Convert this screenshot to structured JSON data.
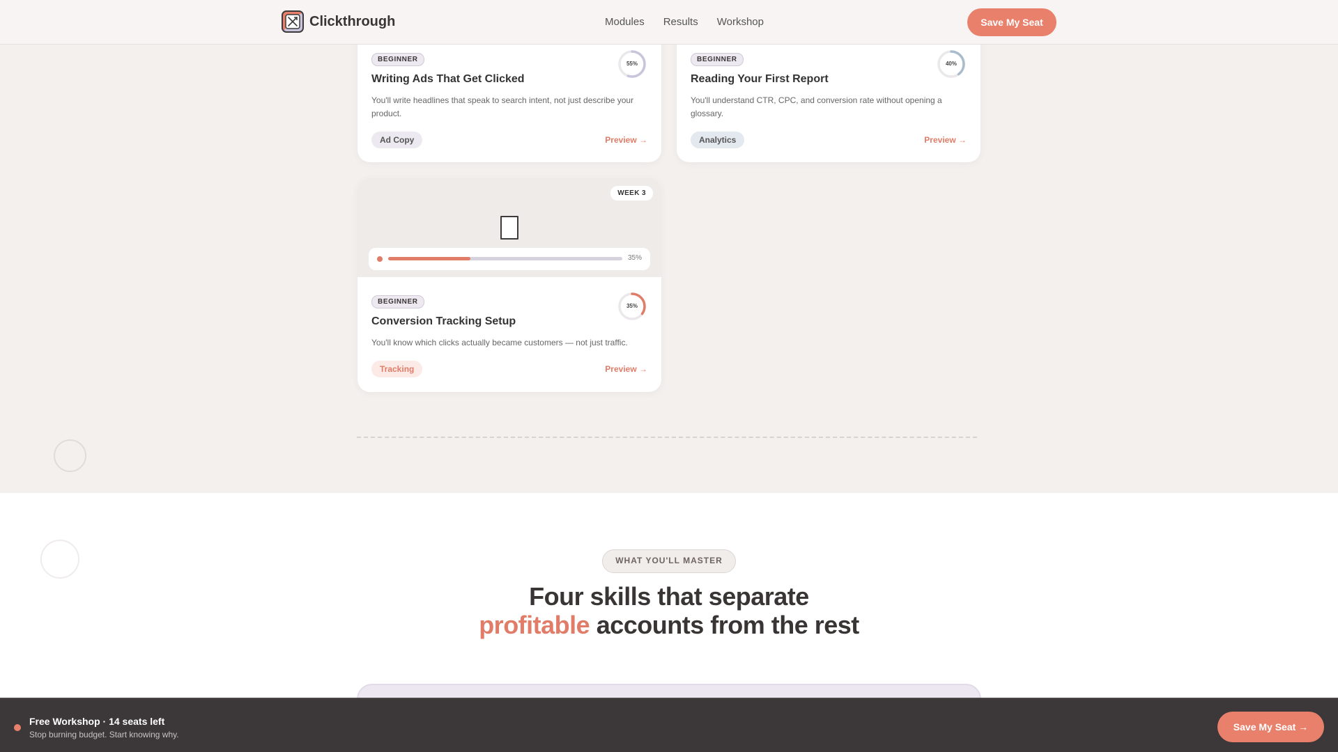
{
  "header": {
    "brand": "Clickthrough",
    "nav": [
      "Modules",
      "Results",
      "Workshop"
    ],
    "cta": "Save My Seat"
  },
  "cards": [
    {
      "level": "BEGINNER",
      "title": "Writing Ads That Get Clicked",
      "desc": "You'll write headlines that speak to search intent, not just describe your product.",
      "progress_pct": 55,
      "progress_label": "55%",
      "ring_color": "#c9c5dc",
      "tag": "Ad Copy",
      "tag_bg": "#ece9f0",
      "tag_color": "#555",
      "preview": "Preview →"
    },
    {
      "level": "BEGINNER",
      "title": "Reading Your First Report",
      "desc": "You'll understand CTR, CPC, and conversion rate without opening a glossary.",
      "progress_pct": 40,
      "progress_label": "40%",
      "ring_color": "#a9bccb",
      "tag": "Analytics",
      "tag_bg": "#e3e9ef",
      "tag_color": "#555",
      "preview": "Preview →"
    },
    {
      "week": "WEEK 3",
      "media_progress_pct": 35,
      "media_progress_label": "35%",
      "level": "BEGINNER",
      "title": "Conversion Tracking Setup",
      "desc": "You'll know which clicks actually became customers — not just traffic.",
      "progress_pct": 35,
      "progress_label": "35%",
      "ring_color": "#e07c68",
      "tag": "Tracking",
      "tag_bg": "#fbeae6",
      "tag_color": "#e07c68",
      "preview": "Preview →"
    }
  ],
  "section2": {
    "eyebrow": "WHAT YOU'LL MASTER",
    "headline_line1": "Four skills that separate",
    "headline_accent": "profitable",
    "headline_line2_rest": " accounts from the rest"
  },
  "bottom_bar": {
    "title": "Free Workshop · 14 seats left",
    "subtitle": "Stop burning budget. Start knowing why.",
    "cta": "Save My Seat →"
  },
  "colors": {
    "accent": "#e8806c",
    "dark": "#3c383a",
    "background": "#f4f0ee"
  },
  "icons": [
    "logo-icon",
    "device-icon",
    "arrow-right-icon"
  ]
}
